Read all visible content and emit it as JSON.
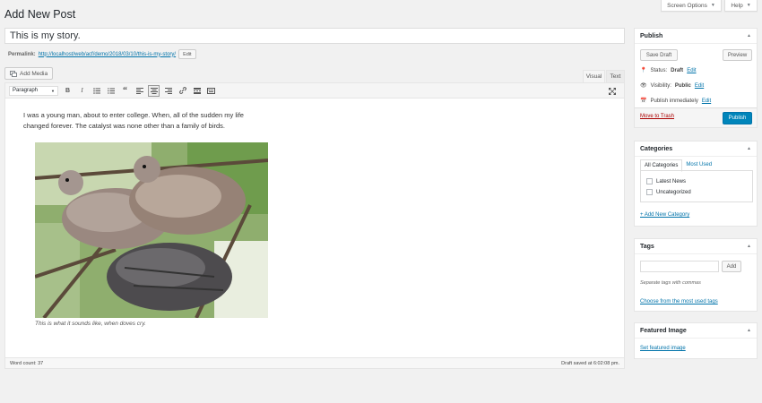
{
  "header": {
    "title": "Add New Post",
    "screen_options": "Screen Options",
    "help": "Help"
  },
  "post": {
    "title": "This is my story.",
    "permalink_label": "Permalink:",
    "permalink_url": "http://localhost/web/acf/demo/2018/03/10/this-is-my-story/",
    "edit_label": "Edit"
  },
  "editor": {
    "add_media": "Add Media",
    "tab_visual": "Visual",
    "tab_text": "Text",
    "format": "Paragraph",
    "paragraph_line1": "I was a young man, about to enter college. When, all of the sudden my life",
    "paragraph_line2": "changed forever. The catalyst was none other than a family of birds.",
    "caption": "This is what it sounds like, when doves cry.",
    "word_count": "Word count: 37",
    "draft_saved": "Draft saved at 6:02:08 pm."
  },
  "publish_box": {
    "title": "Publish",
    "save_draft": "Save Draft",
    "preview": "Preview",
    "status_label": "Status:",
    "status_value": "Draft",
    "visibility_label": "Visibility:",
    "visibility_value": "Public",
    "schedule": "Publish immediately",
    "edit": "Edit",
    "trash": "Move to Trash",
    "publish": "Publish"
  },
  "categories_box": {
    "title": "Categories",
    "tab_all": "All Categories",
    "tab_used": "Most Used",
    "items": [
      "Latest News",
      "Uncategorized"
    ],
    "add_new": "+ Add New Category"
  },
  "tags_box": {
    "title": "Tags",
    "add": "Add",
    "hint": "Separate tags with commas",
    "choose": "Choose from the most used tags"
  },
  "featured_box": {
    "title": "Featured Image",
    "set": "Set featured image"
  },
  "colors": {
    "primary": "#0085ba",
    "link": "#0073aa",
    "trash": "#a00"
  }
}
